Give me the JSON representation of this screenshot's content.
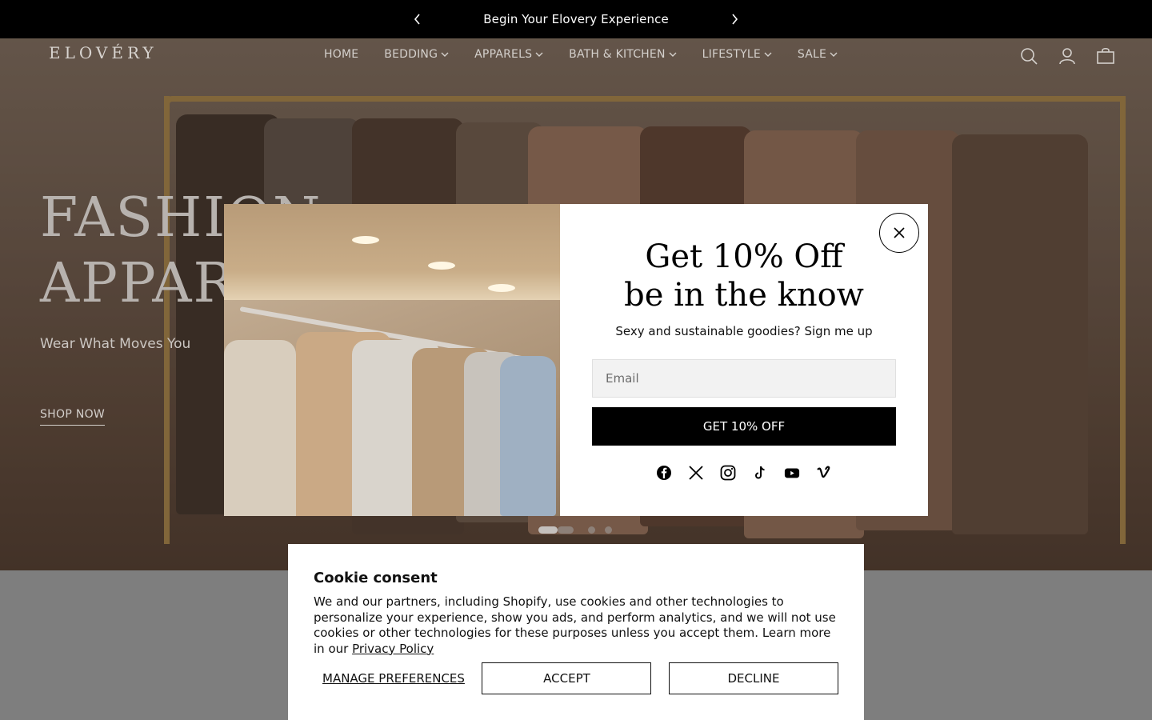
{
  "announcement": {
    "message": "Begin Your Elovery Experience",
    "prev_icon": "chevron-left-icon",
    "next_icon": "chevron-right-icon"
  },
  "header": {
    "logo": "ELOVÉRY",
    "nav": [
      {
        "label": "HOME",
        "dropdown": false
      },
      {
        "label": "BEDDING",
        "dropdown": true
      },
      {
        "label": "APPARELS",
        "dropdown": true
      },
      {
        "label": "BATH & KITCHEN",
        "dropdown": true
      },
      {
        "label": "LIFESTYLE",
        "dropdown": true
      },
      {
        "label": "SALE",
        "dropdown": true
      }
    ],
    "icons": [
      "search-icon",
      "account-icon",
      "cart-icon"
    ]
  },
  "hero": {
    "title_line1": "FASHION",
    "title_line2": "APPAREL",
    "subtitle": "Wear What Moves You",
    "cta": "SHOP NOW",
    "slide_count": 4,
    "active_slide": 1
  },
  "popup": {
    "title_line1": "Get 10% Off",
    "title_line2": "be in the know",
    "subtitle": "Sexy and sustainable goodies? Sign me up",
    "email_placeholder": "Email",
    "submit_label": "GET 10% OFF",
    "close_icon": "close-icon",
    "social": [
      "facebook-icon",
      "x-icon",
      "instagram-icon",
      "tiktok-icon",
      "youtube-icon",
      "vimeo-icon"
    ]
  },
  "cookie": {
    "title": "Cookie consent",
    "body": "We and our partners, including Shopify, use cookies and other technologies to personalize your experience, show you ads, and perform analytics, and we will not use cookies or other technologies for these purposes unless you accept them. Learn more in our ",
    "link": "Privacy Policy",
    "manage_label": "MANAGE PREFERENCES",
    "accept_label": "ACCEPT",
    "decline_label": "DECLINE"
  }
}
